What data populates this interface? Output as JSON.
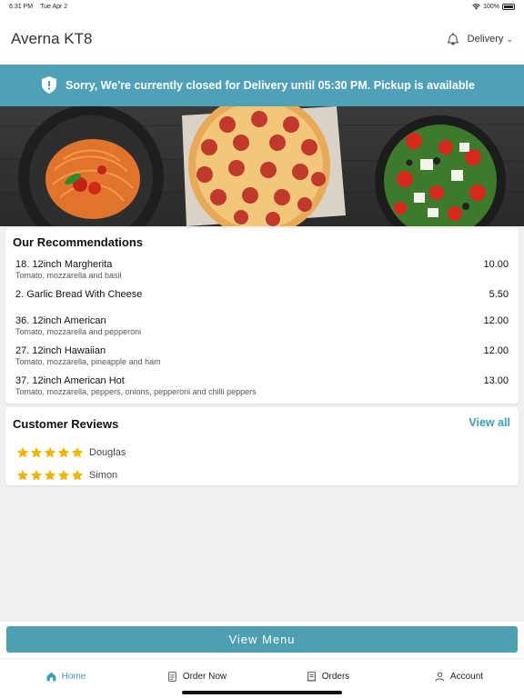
{
  "status": {
    "time": "6:31 PM",
    "date": "Tue Apr 2",
    "battery": "100%"
  },
  "header": {
    "title": "Averna KT8",
    "mode": "Delivery"
  },
  "banner": {
    "message": "Sorry, We're currently closed for Delivery until 05:30 PM. Pickup is available"
  },
  "recommendations": {
    "title": "Our Recommendations",
    "items": [
      {
        "name": "18. 12inch Margherita",
        "desc": "Tomato, mozzarella and basil",
        "price": "10.00"
      },
      {
        "name": "2. Garlic Bread With Cheese",
        "desc": "",
        "price": "5.50"
      },
      {
        "name": "36. 12inch American",
        "desc": "Tomato, mozzarella and pepperoni",
        "price": "12.00"
      },
      {
        "name": "27. 12inch Hawaiian",
        "desc": "Tomato, mozzarella, pineapple and ham",
        "price": "12.00"
      },
      {
        "name": "37. 12inch American Hot",
        "desc": "Tomato, mozzarella, peppers, onions, pepperoni and chilli peppers",
        "price": "13.00"
      }
    ]
  },
  "reviews": {
    "title": "Customer Reviews",
    "view_all": "View all",
    "items": [
      {
        "name": "Douglas",
        "rating": 5
      },
      {
        "name": "Simon",
        "rating": 5
      }
    ]
  },
  "view_menu": "View Menu",
  "tabs": [
    {
      "label": "Home",
      "icon": "home-icon",
      "active": true
    },
    {
      "label": "Order Now",
      "icon": "order-icon",
      "active": false
    },
    {
      "label": "Orders",
      "icon": "receipt-icon",
      "active": false
    },
    {
      "label": "Account",
      "icon": "user-icon",
      "active": false
    }
  ],
  "colors": {
    "accent": "#4ea1b6",
    "link": "#3a9cb8",
    "star": "#f5b400"
  }
}
